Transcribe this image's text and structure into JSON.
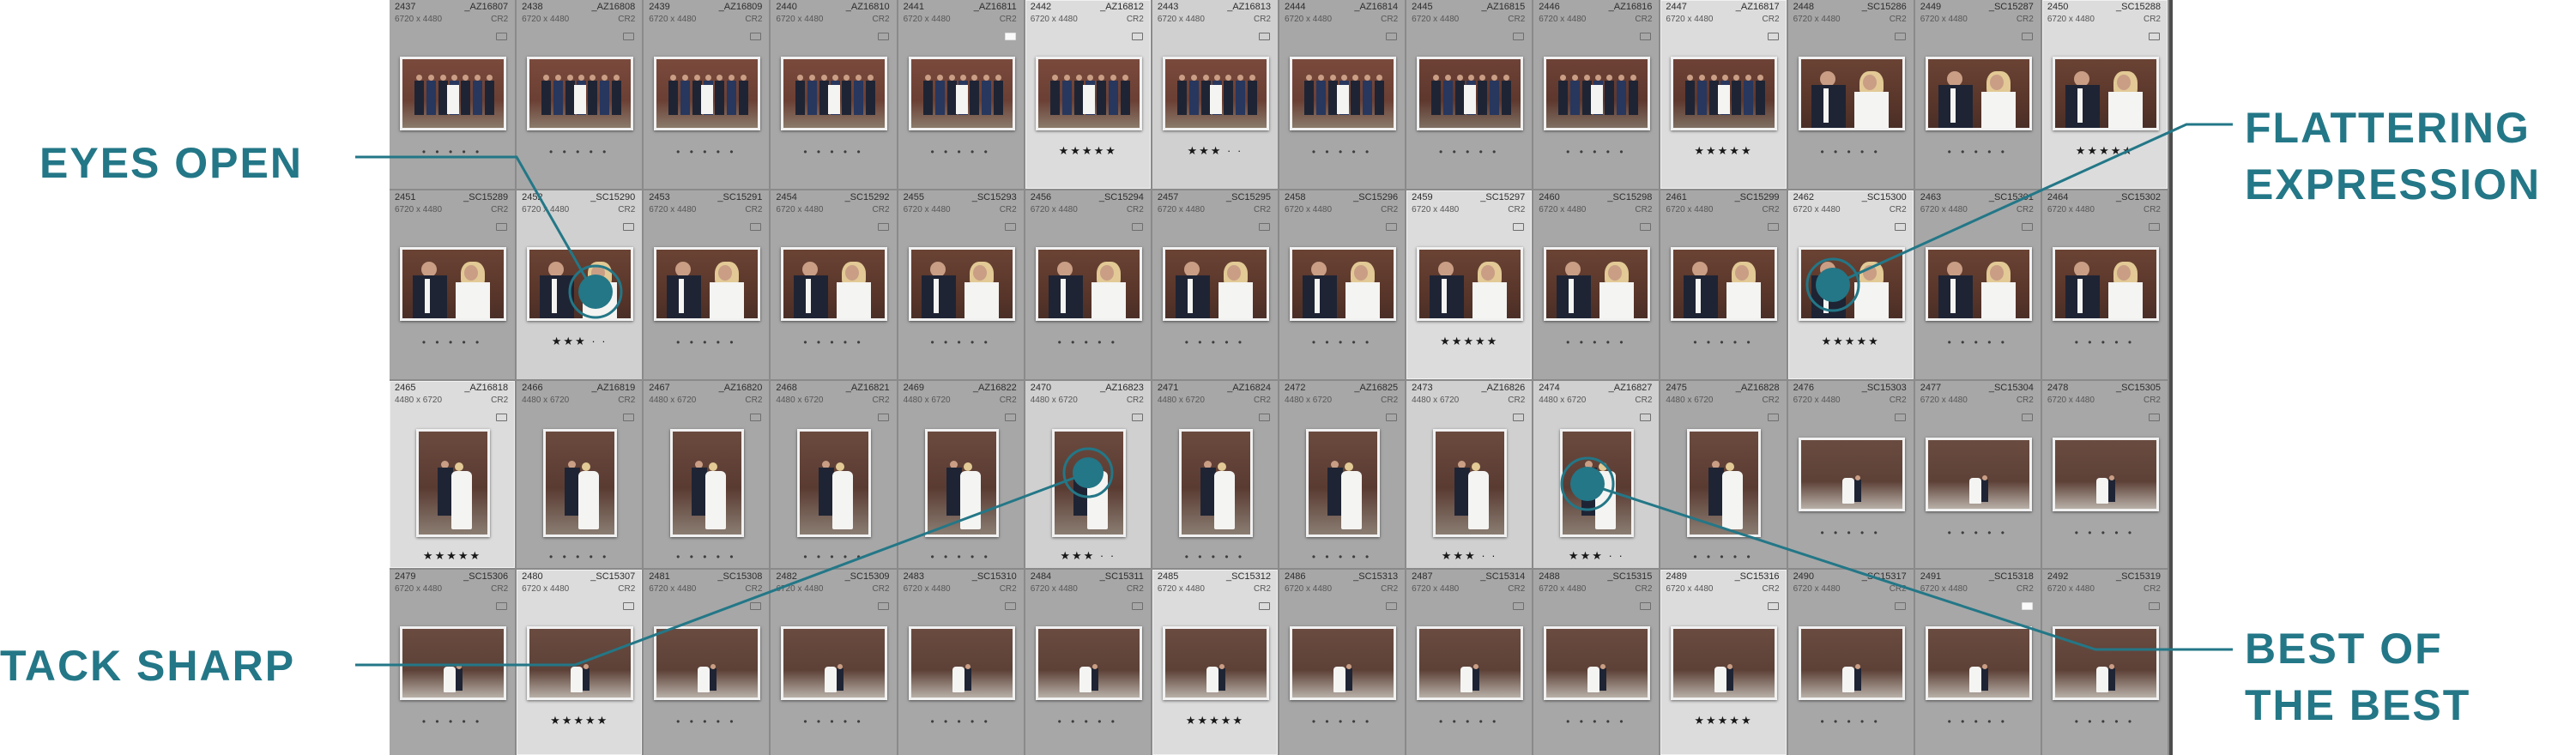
{
  "colors": {
    "accent": "#237787",
    "grid": "#9d9d9d",
    "cell": "#a7a7a7",
    "selected_cell": "#d0d0d0"
  },
  "callouts": [
    {
      "id": "eyes",
      "lines": [
        "EYES OPEN"
      ]
    },
    {
      "id": "flattering",
      "lines": [
        "FLATTERING",
        "EXPRESSION"
      ]
    },
    {
      "id": "tack",
      "lines": [
        "TACK SHARP"
      ]
    },
    {
      "id": "best",
      "lines": [
        "BEST OF",
        "THE BEST"
      ]
    }
  ],
  "grid": {
    "columns": 14,
    "rows": [
      {
        "dims": "6720 x 4480",
        "ext": "CR2",
        "cells": [
          {
            "idx": "2437",
            "file": "_AZ16807",
            "photo": "group",
            "sel": false,
            "rating": ""
          },
          {
            "idx": "2438",
            "file": "_AZ16808",
            "photo": "group",
            "sel": false,
            "rating": ""
          },
          {
            "idx": "2439",
            "file": "_AZ16809",
            "photo": "group",
            "sel": false,
            "rating": ""
          },
          {
            "idx": "2440",
            "file": "_AZ16810",
            "photo": "group",
            "sel": false,
            "rating": ""
          },
          {
            "idx": "2441",
            "file": "_AZ16811",
            "photo": "group",
            "sel": false,
            "rating": "",
            "flag": "white"
          },
          {
            "idx": "2442",
            "file": "_AZ16812",
            "photo": "group",
            "sel": true,
            "rating": "★★★★★"
          },
          {
            "idx": "2443",
            "file": "_AZ16813",
            "photo": "group",
            "sel": true,
            "rating": "★★★ · ·"
          },
          {
            "idx": "2444",
            "file": "_AZ16814",
            "photo": "group",
            "sel": false,
            "rating": ""
          },
          {
            "idx": "2445",
            "file": "_AZ16815",
            "photo": "group2",
            "sel": false,
            "rating": ""
          },
          {
            "idx": "2446",
            "file": "_AZ16816",
            "photo": "group2",
            "sel": false,
            "rating": ""
          },
          {
            "idx": "2447",
            "file": "_AZ16817",
            "photo": "group2",
            "sel": true,
            "rating": "★★★★★"
          },
          {
            "idx": "2448",
            "file": "_SC15286",
            "photo": "couple",
            "sel": false,
            "rating": ""
          },
          {
            "idx": "2449",
            "file": "_SC15287",
            "photo": "couple",
            "sel": false,
            "rating": ""
          },
          {
            "idx": "2450",
            "file": "_SC15288",
            "photo": "couple",
            "sel": true,
            "rating": "★★★★★"
          }
        ]
      },
      {
        "dims": "6720 x 4480",
        "ext": "CR2",
        "cells": [
          {
            "idx": "2451",
            "file": "_SC15289",
            "photo": "couple",
            "sel": false,
            "rating": ""
          },
          {
            "idx": "2452",
            "file": "_SC15290",
            "photo": "couple",
            "sel": true,
            "rating": "★★★ · ·"
          },
          {
            "idx": "2453",
            "file": "_SC15291",
            "photo": "couple",
            "sel": false,
            "rating": ""
          },
          {
            "idx": "2454",
            "file": "_SC15292",
            "photo": "couple",
            "sel": false,
            "rating": ""
          },
          {
            "idx": "2455",
            "file": "_SC15293",
            "photo": "couple",
            "sel": false,
            "rating": ""
          },
          {
            "idx": "2456",
            "file": "_SC15294",
            "photo": "couple",
            "sel": false,
            "rating": ""
          },
          {
            "idx": "2457",
            "file": "_SC15295",
            "photo": "couple",
            "sel": false,
            "rating": ""
          },
          {
            "idx": "2458",
            "file": "_SC15296",
            "photo": "couple",
            "sel": false,
            "rating": ""
          },
          {
            "idx": "2459",
            "file": "_SC15297",
            "photo": "couple",
            "sel": true,
            "rating": "★★★★★"
          },
          {
            "idx": "2460",
            "file": "_SC15298",
            "photo": "couple",
            "sel": false,
            "rating": ""
          },
          {
            "idx": "2461",
            "file": "_SC15299",
            "photo": "couple",
            "sel": false,
            "rating": ""
          },
          {
            "idx": "2462",
            "file": "_SC15300",
            "photo": "couple",
            "sel": true,
            "rating": "★★★★★"
          },
          {
            "idx": "2463",
            "file": "_SC15301",
            "photo": "couple",
            "sel": false,
            "rating": ""
          },
          {
            "idx": "2464",
            "file": "_SC15302",
            "photo": "couple",
            "sel": false,
            "rating": ""
          }
        ]
      },
      {
        "dims": "4480 x 6720",
        "ext": "CR2",
        "cells": [
          {
            "idx": "2465",
            "file": "_AZ16818",
            "photo": "portrait",
            "sel": true,
            "rating": "★★★★★"
          },
          {
            "idx": "2466",
            "file": "_AZ16819",
            "photo": "portrait",
            "sel": false,
            "rating": ""
          },
          {
            "idx": "2467",
            "file": "_AZ16820",
            "photo": "portrait",
            "sel": false,
            "rating": ""
          },
          {
            "idx": "2468",
            "file": "_AZ16821",
            "photo": "portrait",
            "sel": false,
            "rating": ""
          },
          {
            "idx": "2469",
            "file": "_AZ16822",
            "photo": "portrait",
            "sel": false,
            "rating": ""
          },
          {
            "idx": "2470",
            "file": "_AZ16823",
            "photo": "portrait",
            "sel": true,
            "rating": "★★★ · ·"
          },
          {
            "idx": "2471",
            "file": "_AZ16824",
            "photo": "portrait",
            "sel": false,
            "rating": ""
          },
          {
            "idx": "2472",
            "file": "_AZ16825",
            "photo": "portrait",
            "sel": false,
            "rating": ""
          },
          {
            "idx": "2473",
            "file": "_AZ16826",
            "photo": "portrait",
            "sel": true,
            "rating": "★★★ · ·"
          },
          {
            "idx": "2474",
            "file": "_AZ16827",
            "photo": "portrait",
            "sel": true,
            "rating": "★★★ · ·"
          },
          {
            "idx": "2475",
            "file": "_AZ16828",
            "photo": "portrait",
            "sel": false,
            "rating": ""
          },
          {
            "idx": "2476",
            "file": "_SC15303",
            "photo": "wide",
            "sel": false,
            "rating": "",
            "dims": "6720 x 4480"
          },
          {
            "idx": "2477",
            "file": "_SC15304",
            "photo": "wide",
            "sel": false,
            "rating": "",
            "dims": "6720 x 4480"
          },
          {
            "idx": "2478",
            "file": "_SC15305",
            "photo": "wide",
            "sel": false,
            "rating": "",
            "dims": "6720 x 4480"
          }
        ]
      },
      {
        "dims": "6720 x 4480",
        "ext": "CR2",
        "cells": [
          {
            "idx": "2479",
            "file": "_SC15306",
            "photo": "wide",
            "sel": false,
            "rating": ""
          },
          {
            "idx": "2480",
            "file": "_SC15307",
            "photo": "wide",
            "sel": true,
            "rating": "★★★★★"
          },
          {
            "idx": "2481",
            "file": "_SC15308",
            "photo": "wide",
            "sel": false,
            "rating": ""
          },
          {
            "idx": "2482",
            "file": "_SC15309",
            "photo": "wide",
            "sel": false,
            "rating": ""
          },
          {
            "idx": "2483",
            "file": "_SC15310",
            "photo": "wide",
            "sel": false,
            "rating": ""
          },
          {
            "idx": "2484",
            "file": "_SC15311",
            "photo": "wide",
            "sel": false,
            "rating": ""
          },
          {
            "idx": "2485",
            "file": "_SC15312",
            "photo": "wide",
            "sel": true,
            "rating": "★★★★★"
          },
          {
            "idx": "2486",
            "file": "_SC15313",
            "photo": "wide",
            "sel": false,
            "rating": ""
          },
          {
            "idx": "2487",
            "file": "_SC15314",
            "photo": "wide",
            "sel": false,
            "rating": ""
          },
          {
            "idx": "2488",
            "file": "_SC15315",
            "photo": "wide",
            "sel": false,
            "rating": ""
          },
          {
            "idx": "2489",
            "file": "_SC15316",
            "photo": "wide",
            "sel": true,
            "rating": "★★★★★"
          },
          {
            "idx": "2490",
            "file": "_SC15317",
            "photo": "wide",
            "sel": false,
            "rating": ""
          },
          {
            "idx": "2491",
            "file": "_SC15318",
            "photo": "wide",
            "sel": false,
            "rating": "",
            "flag": "white"
          },
          {
            "idx": "2492",
            "file": "_SC15319",
            "photo": "wide",
            "sel": false,
            "rating": ""
          }
        ]
      }
    ]
  }
}
